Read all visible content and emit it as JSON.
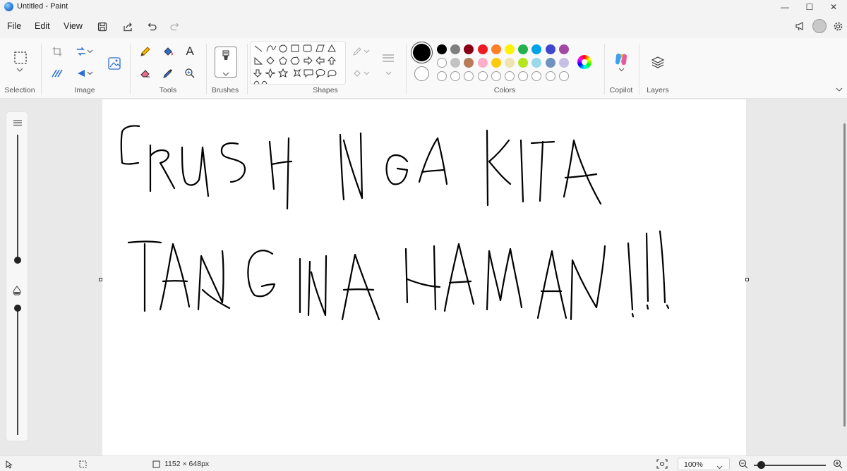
{
  "window": {
    "title": "Untitled - Paint",
    "minimize": "—",
    "maximize": "☐",
    "close": "✕"
  },
  "menu": {
    "file": "File",
    "edit": "Edit",
    "view": "View"
  },
  "ribbon": {
    "groups": {
      "selection": "Selection",
      "image": "Image",
      "tools": "Tools",
      "brushes": "Brushes",
      "shapes": "Shapes",
      "colors": "Colors",
      "copilot": "Copilot",
      "layers": "Layers"
    },
    "tools": {
      "text_glyph": "A"
    },
    "colors": {
      "primary": "#000000",
      "secondary": "#ffffff",
      "row1": [
        "#000000",
        "#7f7f7f",
        "#880015",
        "#ed1c24",
        "#ff7f27",
        "#fff200",
        "#22b14c",
        "#00a2e8",
        "#3f48cc",
        "#a349a4"
      ],
      "row2": [
        "#ffffff",
        "#c3c3c3",
        "#b97a57",
        "#ffaec9",
        "#ffc90e",
        "#efe4b0",
        "#b5e61d",
        "#99d9ea",
        "#7092be",
        "#c8bfe7"
      ],
      "row3_count": 10
    }
  },
  "status": {
    "canvas_size": "1152 × 648px",
    "zoom": "100%",
    "zoom_slider_level": 0.1
  },
  "canvas_drawing": {
    "line1": "CRUSH NGA KITA",
    "line2": "TANGINA HAMAN !!!",
    "stroke_color": "#000000"
  }
}
